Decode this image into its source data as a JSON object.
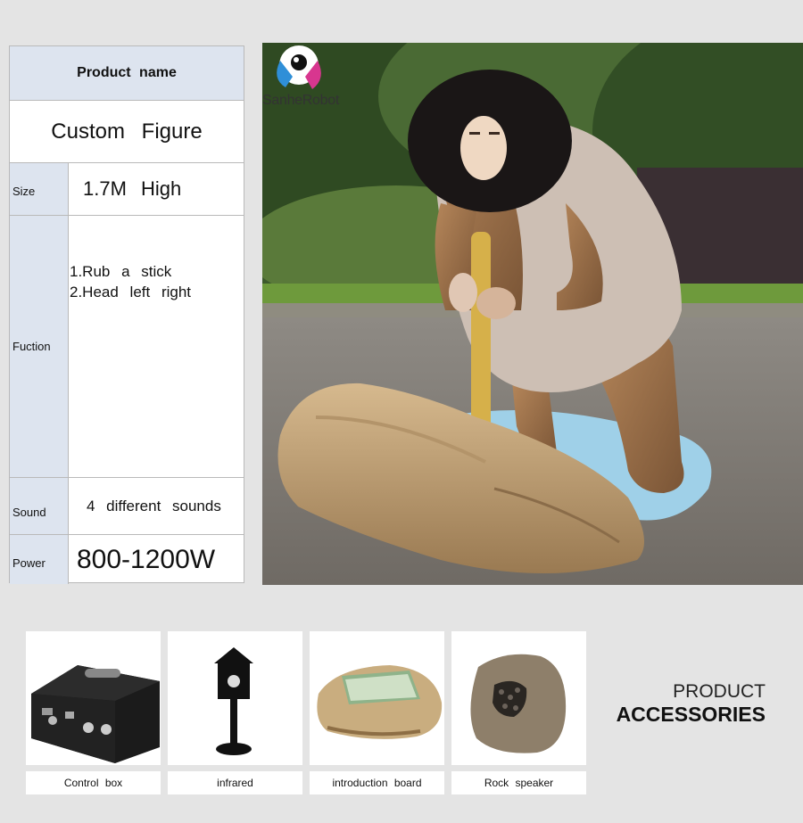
{
  "spec_table": {
    "header": "Product name",
    "product_name": "Custom Figure",
    "rows": {
      "size": {
        "label": "Size",
        "value": "1.7M High"
      },
      "function": {
        "label": "Fuction",
        "items": [
          "1.Rub a stick",
          "2.Head left right"
        ]
      },
      "sound": {
        "label": "Sound",
        "value": "4 different sounds"
      },
      "power": {
        "label": "Power",
        "value": "800-1200W"
      }
    }
  },
  "photo": {
    "watermark": "SanheRobot"
  },
  "accessories": {
    "title_line1": "PRODUCT",
    "title_line2": "ACCESSORIES",
    "items": [
      {
        "label": "Control box",
        "icon": "control-box-image"
      },
      {
        "label": "infrared",
        "icon": "infrared-sensor-image"
      },
      {
        "label": "introduction board",
        "icon": "introduction-board-image"
      },
      {
        "label": "Rock speaker",
        "icon": "rock-speaker-image"
      }
    ]
  }
}
